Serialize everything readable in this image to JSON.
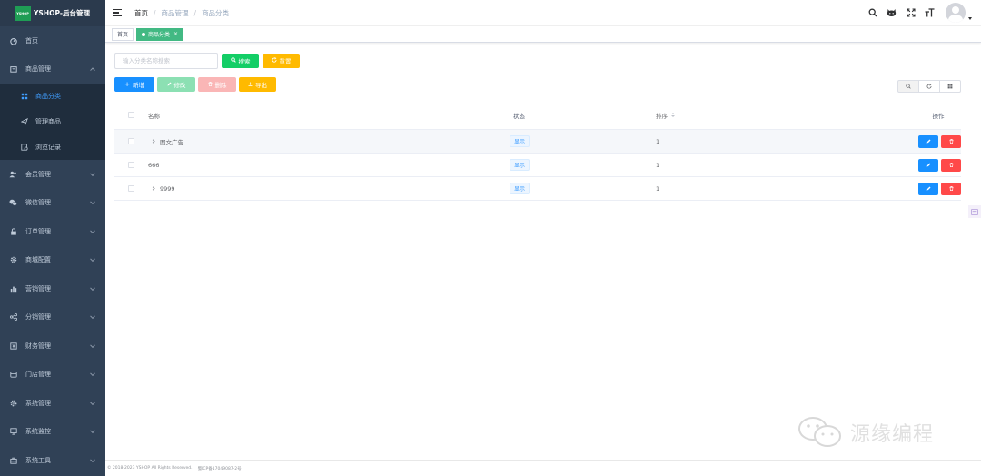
{
  "brand": {
    "logo_text": "YSHOP",
    "title": "YSHOP-后台管理"
  },
  "sidebar": {
    "items": [
      {
        "label": "首页",
        "icon": "dashboard-icon",
        "expandable": false
      },
      {
        "label": "商品管理",
        "icon": "shopping-icon",
        "expandable": true,
        "expanded": true,
        "children": [
          {
            "label": "商品分类",
            "icon": "category-icon",
            "active": true
          },
          {
            "label": "管理商品",
            "icon": "send-icon",
            "active": false
          },
          {
            "label": "浏览记录",
            "icon": "browse-record-icon",
            "active": false
          }
        ]
      },
      {
        "label": "会员管理",
        "icon": "peoples-icon",
        "expandable": true
      },
      {
        "label": "微信管理",
        "icon": "wechat-icon",
        "expandable": true
      },
      {
        "label": "订单管理",
        "icon": "lock-icon",
        "expandable": true
      },
      {
        "label": "商城配置",
        "icon": "gear-icon",
        "expandable": true
      },
      {
        "label": "营销管理",
        "icon": "chart-icon",
        "expandable": true
      },
      {
        "label": "分销管理",
        "icon": "share-icon",
        "expandable": true
      },
      {
        "label": "财务管理",
        "icon": "finance-icon",
        "expandable": true
      },
      {
        "label": "门店管理",
        "icon": "store-icon",
        "expandable": true
      },
      {
        "label": "系统管理",
        "icon": "system-icon",
        "expandable": true
      },
      {
        "label": "系统监控",
        "icon": "monitor-icon",
        "expandable": true
      },
      {
        "label": "系统工具",
        "icon": "tool-icon",
        "expandable": true
      }
    ]
  },
  "header": {
    "breadcrumb": [
      "首页",
      "商品管理",
      "商品分类"
    ],
    "icons": [
      "search-icon",
      "github-icon",
      "fullscreen-icon",
      "font-size-icon"
    ]
  },
  "tags": [
    {
      "label": "首页",
      "active": false
    },
    {
      "label": "商品分类",
      "active": true
    }
  ],
  "toolbar": {
    "search_placeholder": "输入分类名称搜索",
    "search_label": "搜索",
    "reset_label": "重置",
    "add_label": "新增",
    "edit_label": "修改",
    "delete_label": "删除",
    "export_label": "导出"
  },
  "table": {
    "columns": {
      "name": "名称",
      "status": "状态",
      "sort": "排序",
      "operation": "操作"
    },
    "rows": [
      {
        "name": "图文广告",
        "status": "显示",
        "sort": "1",
        "has_children": true,
        "hover": true
      },
      {
        "name": "666",
        "status": "显示",
        "sort": "1",
        "has_children": false,
        "hover": false
      },
      {
        "name": "9999",
        "status": "显示",
        "sort": "1",
        "has_children": true,
        "hover": false
      }
    ]
  },
  "footer": {
    "copyright": "© 2018-2023 YSHOP All Rights Reserved.",
    "icp": "蜀ICP备17049087-2号"
  },
  "watermark": {
    "text": "源缘编程"
  },
  "colors": {
    "sidebar_bg": "#304156",
    "primary": "#1890ff",
    "success": "#13ce66",
    "warning": "#ffba00",
    "danger": "#ff4949",
    "tag_active": "#42b983"
  }
}
